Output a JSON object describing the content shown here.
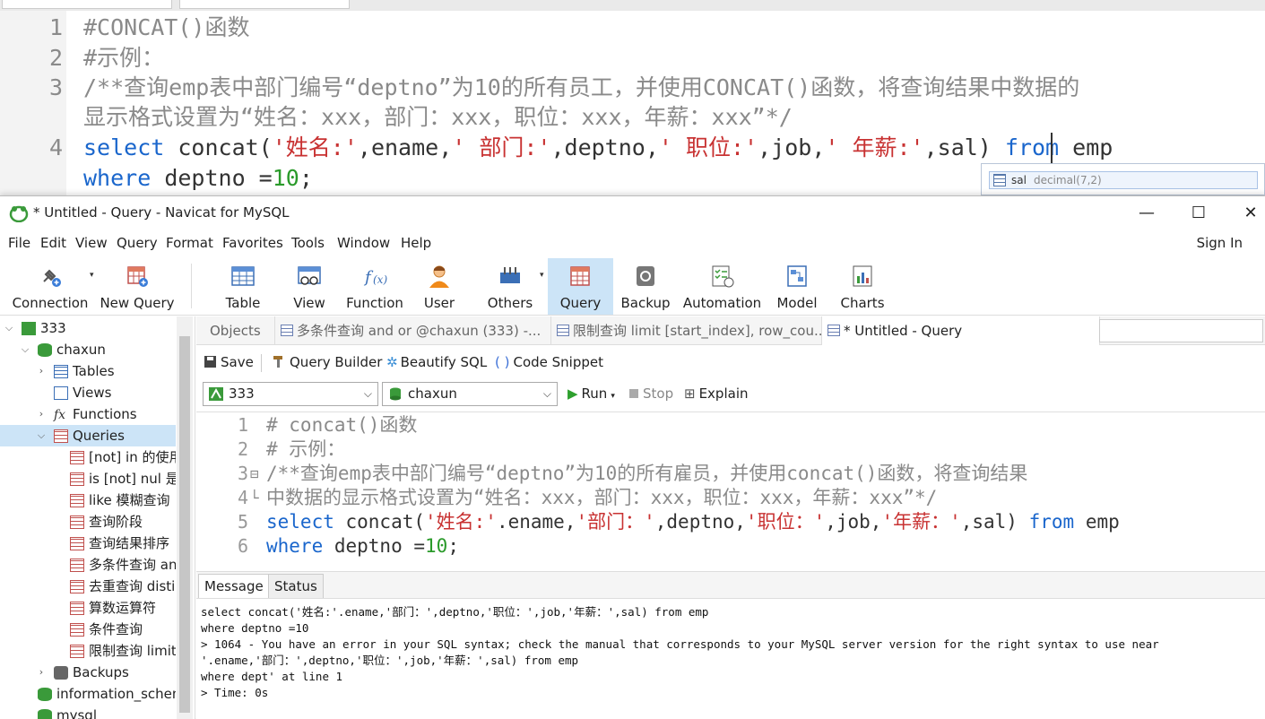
{
  "background_editor": {
    "lines": [
      {
        "num": "1",
        "segments": [
          {
            "t": "#CONCAT()函数",
            "c": "com"
          }
        ]
      },
      {
        "num": "2",
        "segments": [
          {
            "t": "#示例：",
            "c": "com"
          }
        ]
      },
      {
        "num": "3",
        "segments": [
          {
            "t": "/**查询emp表中部门编号“deptno”为10的所有员工，并使用CONCAT()函数，将查询结果中数据的",
            "c": "com"
          }
        ]
      },
      {
        "num": "",
        "segments": [
          {
            "t": "显示格式设置为“姓名：xxx，部门：xxx，职位：xxx，年薪：xxx”*/",
            "c": "com"
          }
        ]
      },
      {
        "num": "4",
        "segments": [
          {
            "t": "select",
            "c": "kw"
          },
          {
            "t": " concat(",
            "c": "txt"
          },
          {
            "t": "'姓名:'",
            "c": "str"
          },
          {
            "t": ",ename,",
            "c": "txt"
          },
          {
            "t": "' 部门:'",
            "c": "str"
          },
          {
            "t": ",deptno,",
            "c": "txt"
          },
          {
            "t": "' 职位:'",
            "c": "str"
          },
          {
            "t": ",job,",
            "c": "txt"
          },
          {
            "t": "' 年薪:'",
            "c": "str"
          },
          {
            "t": ",sal) ",
            "c": "txt"
          },
          {
            "t": "from",
            "c": "kw"
          },
          {
            "t": " emp",
            "c": "txt"
          }
        ]
      },
      {
        "num": "",
        "segments": [
          {
            "t": "where",
            "c": "kw"
          },
          {
            "t": " deptno =",
            "c": "txt"
          },
          {
            "t": "10",
            "c": "num"
          },
          {
            "t": ";",
            "c": "txt"
          }
        ]
      }
    ],
    "autocomplete": {
      "name": "sal",
      "type": "decimal(7,2)"
    }
  },
  "window": {
    "title": "* Untitled - Query - Navicat for MySQL",
    "minimize": "—",
    "maximize": "☐",
    "close": "✕"
  },
  "menu": [
    "File",
    "Edit",
    "View",
    "Query",
    "Format",
    "Favorites",
    "Tools",
    "Window",
    "Help"
  ],
  "sign_in": "Sign In",
  "toolbar": {
    "connection": "Connection",
    "new_query": "New Query",
    "table": "Table",
    "view": "View",
    "function": "Function",
    "user": "User",
    "others": "Others",
    "query": "Query",
    "backup": "Backup",
    "automation": "Automation",
    "model": "Model",
    "charts": "Charts"
  },
  "sidebar": {
    "items": [
      {
        "label": "333",
        "icon": "connection-icon"
      },
      {
        "label": "chaxun",
        "icon": "database-icon"
      },
      {
        "label": "Tables",
        "icon": "table-icon"
      },
      {
        "label": "Views",
        "icon": "view-icon"
      },
      {
        "label": "Functions",
        "icon": "function-icon"
      },
      {
        "label": "Queries",
        "icon": "query-icon"
      },
      {
        "label": "[not] in 的使用",
        "icon": "query-icon"
      },
      {
        "label": "is [not] nul 是否",
        "icon": "query-icon"
      },
      {
        "label": "like 模糊查询",
        "icon": "query-icon"
      },
      {
        "label": "查询阶段",
        "icon": "query-icon"
      },
      {
        "label": "查询结果排序",
        "icon": "query-icon"
      },
      {
        "label": "多条件查询  and",
        "icon": "query-icon"
      },
      {
        "label": "去重查询 distinct",
        "icon": "query-icon"
      },
      {
        "label": "算数运算符",
        "icon": "query-icon"
      },
      {
        "label": "条件查询",
        "icon": "query-icon"
      },
      {
        "label": "限制查询 limit",
        "icon": "query-icon"
      },
      {
        "label": "Backups",
        "icon": "backup-icon"
      },
      {
        "label": "information_schema",
        "icon": "database-icon"
      },
      {
        "label": "mysql",
        "icon": "database-icon"
      }
    ]
  },
  "tabs": {
    "objects": "Objects",
    "tab1": "多条件查询  and     or @chaxun (333) -...",
    "tab2": "限制查询 limit [start_index], row_cou...",
    "tab3": "* Untitled - Query"
  },
  "query_toolbar": {
    "save": "Save",
    "query_builder": "Query Builder",
    "beautify": "Beautify SQL",
    "snippet": "Code Snippet"
  },
  "selectors": {
    "connection": "333",
    "database": "chaxun",
    "run": "Run",
    "stop": "Stop",
    "explain": "Explain"
  },
  "editor": {
    "lines": [
      {
        "num": "1",
        "fold": "",
        "segments": [
          {
            "t": "# concat()函数",
            "c": "com"
          }
        ]
      },
      {
        "num": "2",
        "fold": "",
        "segments": [
          {
            "t": "# 示例：",
            "c": "com"
          }
        ]
      },
      {
        "num": "3",
        "fold": "⊟",
        "segments": [
          {
            "t": "/**查询emp表中部门编号“deptno”为10的所有雇员，并使用concat()函数，将查询结果",
            "c": "com"
          }
        ]
      },
      {
        "num": "4",
        "fold": "└",
        "segments": [
          {
            "t": "中数据的显示格式设置为“姓名：xxx，部门：xxx，职位：xxx，年薪：xxx”*/",
            "c": "com"
          }
        ]
      },
      {
        "num": "5",
        "fold": "",
        "segments": [
          {
            "t": "select",
            "c": "kw"
          },
          {
            "t": " concat(",
            "c": "txt"
          },
          {
            "t": "'姓名:'",
            "c": "str"
          },
          {
            "t": ".ename,",
            "c": "txt"
          },
          {
            "t": "'部门：'",
            "c": "str"
          },
          {
            "t": ",deptno,",
            "c": "txt"
          },
          {
            "t": "'职位：'",
            "c": "str"
          },
          {
            "t": ",job,",
            "c": "txt"
          },
          {
            "t": "'年薪：'",
            "c": "str"
          },
          {
            "t": ",sal) ",
            "c": "txt"
          },
          {
            "t": "from",
            "c": "kw"
          },
          {
            "t": " emp",
            "c": "txt"
          }
        ]
      },
      {
        "num": "6",
        "fold": "",
        "segments": [
          {
            "t": "where",
            "c": "kw"
          },
          {
            "t": " deptno =",
            "c": "txt"
          },
          {
            "t": "10",
            "c": "num"
          },
          {
            "t": ";",
            "c": "txt"
          }
        ]
      }
    ]
  },
  "message_tabs": {
    "message": "Message",
    "status": "Status"
  },
  "message_lines": [
    "select concat('姓名:'.ename,'部门：',deptno,'职位：',job,'年薪：',sal) from emp",
    "where deptno =10",
    "> 1064 - You have an error in your SQL syntax; check the manual that corresponds to your MySQL server version for the right syntax to use near",
    "'.ename,'部门：',deptno,'职位：',job,'年薪：',sal) from emp",
    "where dept' at line 1",
    "> Time: 0s"
  ],
  "colors": {
    "keyword": "#1a66cc",
    "string": "#c83232",
    "number": "#2a9a2a",
    "comment": "#8a8a8a",
    "selection": "#cce4f7"
  }
}
